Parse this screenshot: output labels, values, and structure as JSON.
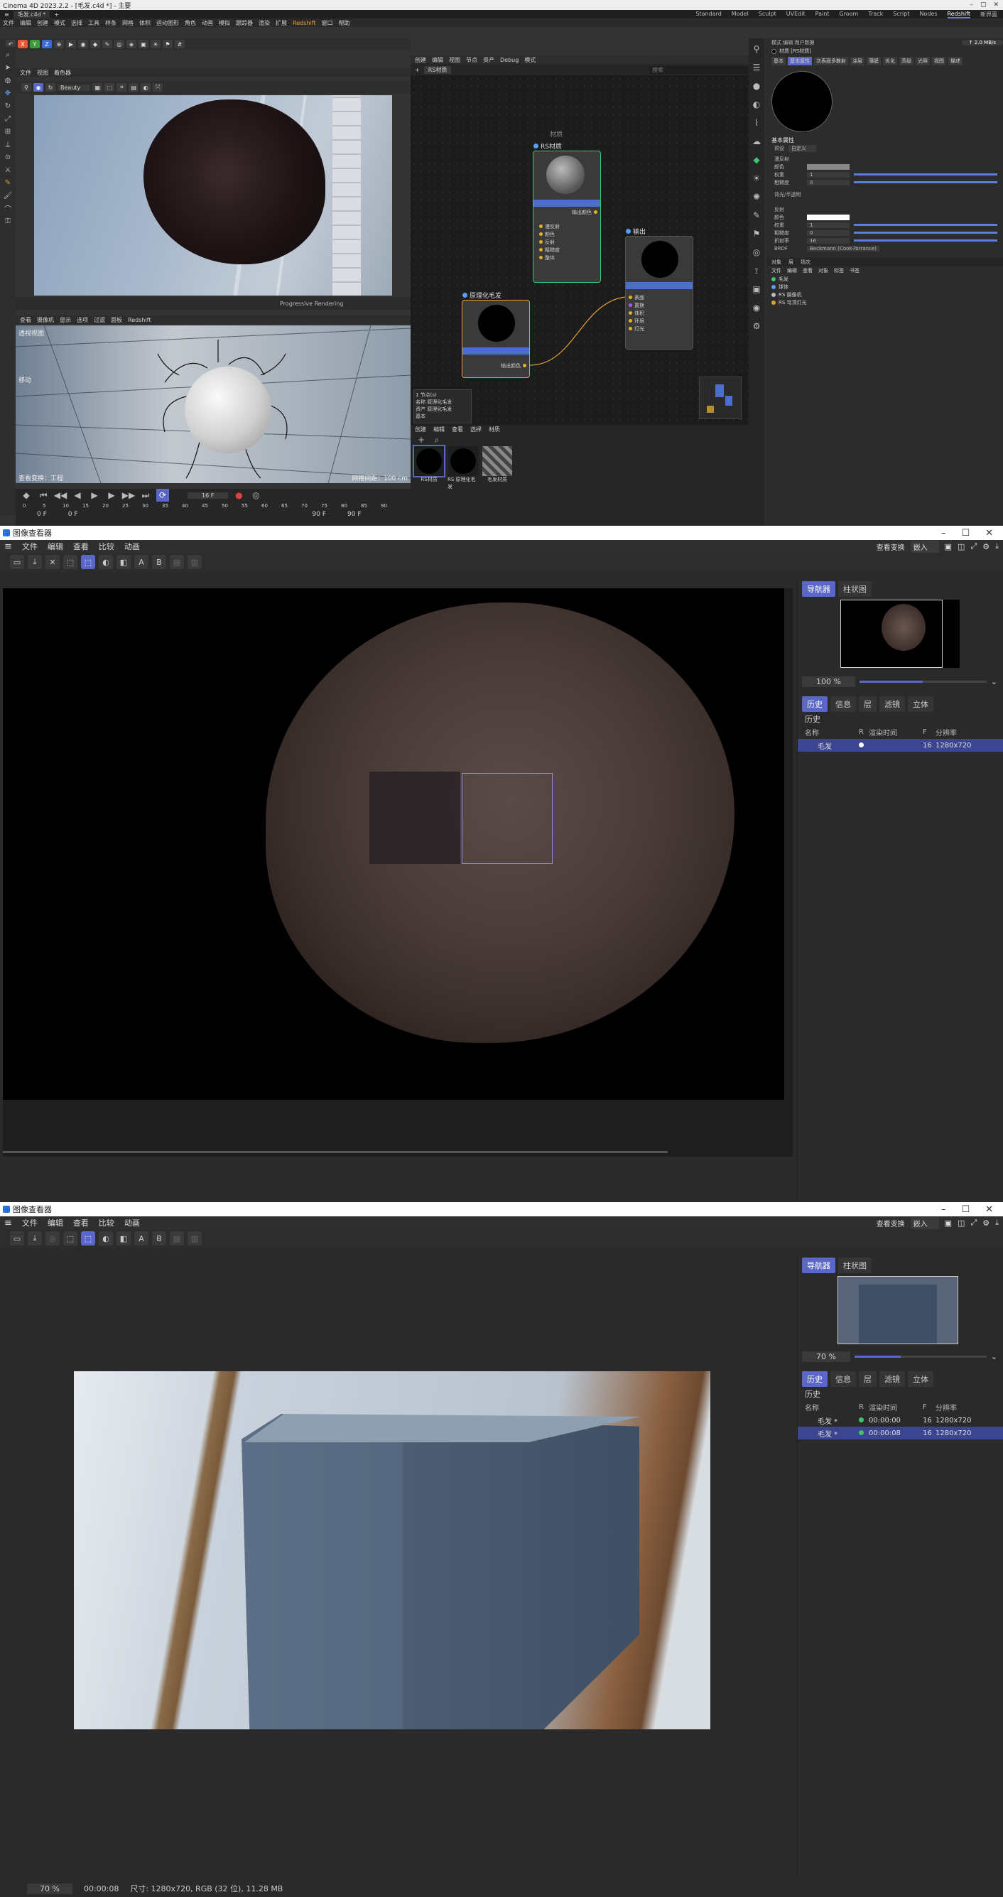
{
  "c4d": {
    "title": "Cinema 4D 2023.2.2 - [毛发.c4d *] - 主要",
    "doc_tab": "毛发.c4d *",
    "layouts": [
      "Standard",
      "Model",
      "Sculpt",
      "UVEdit",
      "Paint",
      "Groom",
      "Track",
      "Script",
      "Nodes",
      "Redshift",
      "新界面"
    ],
    "active_layout": "Redshift",
    "menu": [
      "文件",
      "编辑",
      "创建",
      "模式",
      "选择",
      "工具",
      "样条",
      "网格",
      "体积",
      "运动图形",
      "角色",
      "动画",
      "模拟",
      "跟踪器",
      "渲染",
      "扩展",
      "Redshift",
      "窗口",
      "帮助"
    ],
    "viewport_top": {
      "menu": [
        "文件",
        "视图",
        "着色器"
      ],
      "renderer": "Beauty",
      "label": "Progressive Rendering"
    },
    "viewport_bottom": {
      "menu": [
        "查看",
        "摄像机",
        "显示",
        "选项",
        "过滤",
        "面板",
        "Redshift"
      ],
      "camera": "透视视图",
      "mode": "移动",
      "footer_left": "查看变换：工程",
      "footer_right": "网格间距：100 cm"
    },
    "timeline": {
      "frame": "16 F",
      "ticks": [
        "0",
        "5",
        "10",
        "15",
        "20",
        "25",
        "30",
        "35",
        "40",
        "45",
        "50",
        "55",
        "60",
        "65",
        "70",
        "75",
        "80",
        "85",
        "90"
      ],
      "start": "0 F",
      "start2": "0 F",
      "end": "90 F",
      "end2": "90 F"
    },
    "node_editor": {
      "menu": [
        "创建",
        "编辑",
        "视图",
        "节点",
        "资产",
        "Debug",
        "模式"
      ],
      "tab": "RS材质",
      "search_placeholder": "搜索",
      "group_label": "材质",
      "node_rs": {
        "title": "RS材质",
        "out": "输出颜色",
        "ports": [
          "漫反射",
          "颜色",
          "反射",
          "粗糙度",
          "整体"
        ]
      },
      "node_out": {
        "title": "输出",
        "ports": [
          "表面",
          "置换",
          "体积",
          "环境",
          "灯光"
        ]
      },
      "node_hair": {
        "title": "原理化毛发",
        "out": "输出颜色"
      },
      "info": [
        "1 节点(s)",
        "名称 原理化毛发",
        "资产 原理化毛发",
        "基本"
      ]
    },
    "materials": {
      "menu": [
        "创建",
        "编辑",
        "查看",
        "选择",
        "材质"
      ],
      "items": [
        "RS材质",
        "RS 原理化毛发",
        "毛发材质"
      ]
    },
    "attributes": {
      "header": "模式 编辑 用户数据",
      "object": "材质 [RS材质]",
      "tabs": [
        "基本",
        "基本属性",
        "次表面多散射",
        "涂层",
        "薄膜",
        "优化",
        "高级",
        "光照",
        "视图",
        "描述"
      ],
      "section": "基本属性",
      "preset": "预设",
      "preset_value": "自定义",
      "diffuse_label": "漫反射",
      "diffuse_rows": [
        {
          "label": "颜色",
          "value": ""
        },
        {
          "label": "权重",
          "value": "1"
        },
        {
          "label": "粗糙度",
          "value": "0"
        }
      ],
      "backlight": "背光/半透明",
      "reflection_label": "反射",
      "reflection_rows": [
        {
          "label": "颜色",
          "value": ""
        },
        {
          "label": "权重",
          "value": "1"
        },
        {
          "label": "粗糙度",
          "value": "0"
        },
        {
          "label": "折射率",
          "value": "16"
        },
        {
          "label": "BRDF",
          "value": "Beckmann (Cook-Torrance)"
        }
      ],
      "obj_tabs": [
        "对象",
        "层",
        "场次"
      ],
      "obj_menu": [
        "文件",
        "编辑",
        "查看",
        "对象",
        "标签",
        "书签"
      ],
      "objects": [
        "毛发",
        "球体",
        "RS 摄像机",
        "RS 穹顶灯光"
      ]
    }
  },
  "viewer1": {
    "title": "图像查看器",
    "menu": [
      "文件",
      "编辑",
      "查看",
      "比较",
      "动画"
    ],
    "view_transform_label": "查看变换",
    "view_transform_value": "嵌入",
    "side_tabs": [
      "导航器",
      "柱状图"
    ],
    "zoom": "100 %",
    "hist_tabs": [
      "历史",
      "信息",
      "层",
      "滤镜",
      "立体"
    ],
    "history_label": "历史",
    "columns": [
      "名称",
      "R",
      "渲染时间",
      "F",
      "分辨率"
    ],
    "rows": [
      {
        "name": "毛发",
        "time": "",
        "frame": "16",
        "res": "1280x720",
        "dot": "#ffffff",
        "selected": true
      }
    ]
  },
  "viewer2": {
    "title": "图像查看器",
    "menu": [
      "文件",
      "编辑",
      "查看",
      "比较",
      "动画"
    ],
    "view_transform_label": "查看变换",
    "view_transform_value": "嵌入",
    "side_tabs": [
      "导航器",
      "柱状图"
    ],
    "zoom": "70 %",
    "hist_tabs": [
      "历史",
      "信息",
      "层",
      "滤镜",
      "立体"
    ],
    "history_label": "历史",
    "columns": [
      "名称",
      "R",
      "渲染时间",
      "F",
      "分辨率"
    ],
    "rows": [
      {
        "name": "毛发 *",
        "time": "00:00:00",
        "frame": "16",
        "res": "1280x720",
        "dot": "#3ec46d",
        "selected": false
      },
      {
        "name": "毛发 *",
        "time": "00:00:08",
        "frame": "16",
        "res": "1280x720",
        "dot": "#3ec46d",
        "selected": true
      }
    ],
    "status": {
      "zoom": "70 %",
      "time": "00:00:08",
      "info": "尺寸: 1280x720, RGB (32 位), 11.28 MB"
    }
  },
  "colors": {
    "accent": "#5a67c8",
    "c4d_blue": "#4a6fd0",
    "orange": "#e0a030",
    "green": "#3ec46d"
  },
  "icons": [
    "search-icon",
    "move-icon",
    "rotate-icon",
    "scale-icon",
    "play-icon",
    "folder-icon",
    "save-icon",
    "close-icon",
    "menu-icon",
    "minimize-icon",
    "maximize-icon",
    "pin-icon"
  ]
}
